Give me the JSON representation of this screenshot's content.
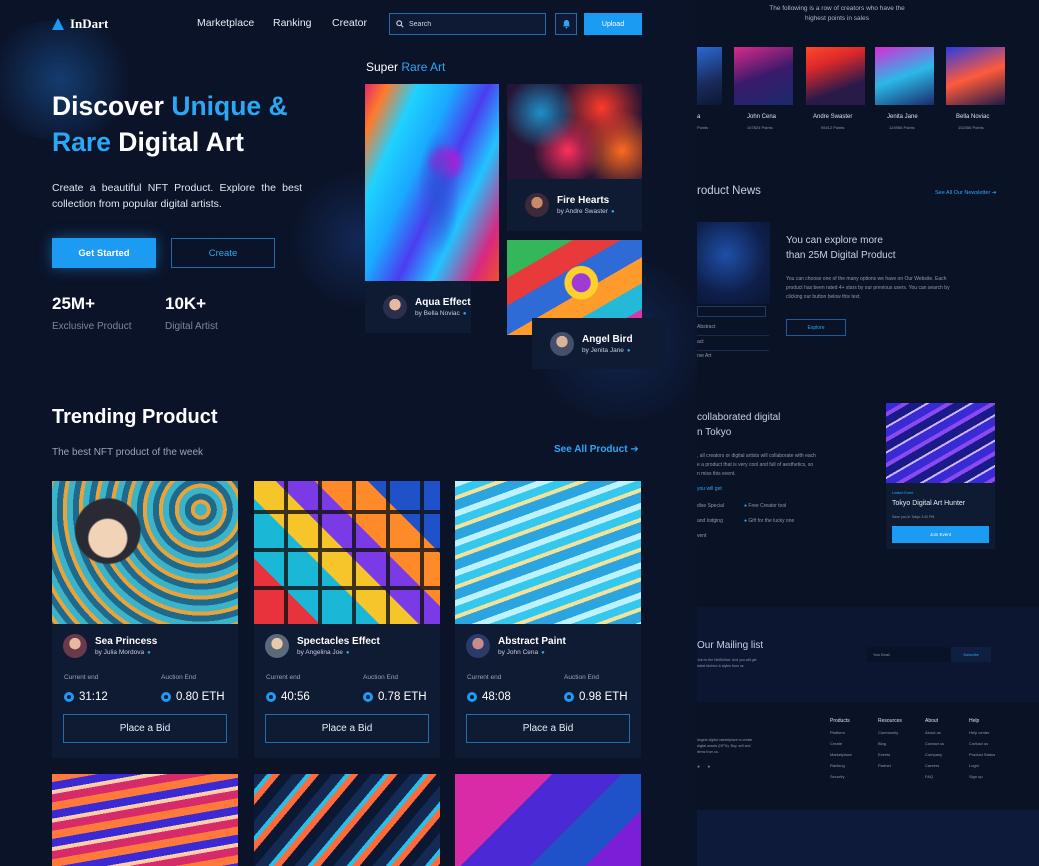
{
  "brand": {
    "name": "InDart"
  },
  "nav": {
    "links": [
      "Marketplace",
      "Ranking",
      "Creator"
    ],
    "search_placeholder": "Search",
    "upload_label": "Upload"
  },
  "hero": {
    "title_parts": [
      "Discover ",
      "Unique &",
      "Rare",
      " Digital Art"
    ],
    "description": "Create a beautiful NFT Product. Explore the best collection from popular digital artists.",
    "primary_button": "Get Started",
    "secondary_button": "Create",
    "stats": [
      {
        "value": "25M+",
        "label": "Exclusive Product"
      },
      {
        "value": "10K+",
        "label": "Digital Artist"
      }
    ]
  },
  "super_rare": {
    "title_white": "Super ",
    "title_blue": "Rare Art",
    "items": [
      {
        "name": "Aqua Effect",
        "by": "by Bella Noviac"
      },
      {
        "name": "Fire Hearts",
        "by": "by Andre Swaster"
      },
      {
        "name": "Angel Bird",
        "by": "by Jenita Jane"
      }
    ]
  },
  "trending": {
    "title": "Trending Product",
    "subtitle": "The best NFT product of the week",
    "see_all": "See All Product",
    "current_end_label": "Current end",
    "auction_end_label": "Auction End",
    "bid_label": "Place a Bid",
    "products": [
      {
        "name": "Sea Princess",
        "by": "by Julia Mordova",
        "current_end": "31:12",
        "auction_end": "0.80 ETH"
      },
      {
        "name": "Spectacles Effect",
        "by": "by Angelina Joe",
        "current_end": "40:56",
        "auction_end": "0.78 ETH"
      },
      {
        "name": "Abstract Paint",
        "by": "by John Cena",
        "current_end": "48:08",
        "auction_end": "0.98 ETH"
      }
    ]
  },
  "side": {
    "top_text_1": "The following is a row of creators who have the",
    "top_text_2": "highest points in sales",
    "creators": [
      {
        "name": "a",
        "points": "Points"
      },
      {
        "name": "John Cena",
        "points": "107824 Points"
      },
      {
        "name": "Andre Swaster",
        "points": "95412 Points"
      },
      {
        "name": "Jenita Jane",
        "points": "124956 Points"
      },
      {
        "name": "Bella Noviac",
        "points": "102456 Points"
      }
    ],
    "news_title": "roduct News",
    "news_link": "See All Our Newsletter",
    "news_heading_1": "You can explore more",
    "news_heading_2": "than 25M Digital Product",
    "news_body_1": "You can choose one of the many options we have on Our Website. Each",
    "news_body_2": "product has been rated 4+ stars by our previous users. You can search by",
    "news_body_3": "clicking our button below this text.",
    "explore_label": "Explore",
    "news_list": [
      "Abstract",
      "act",
      "rse Art"
    ],
    "event_title_1": "collaborated digital",
    "event_title_2": "n Tokyo",
    "event_desc_1": ", all creators or digital artists will collaborate with each",
    "event_desc_2": "e a product that is very cool and full of aesthetics, so",
    "event_desc_3": "n miss this event.",
    "event_get": "you will get",
    "event_items": [
      "dise Special",
      "Free Creator tool",
      "and lodging",
      "Gift for the lucky one",
      "vent"
    ],
    "event_card_tag": "Limited Event",
    "event_card_title": "Tokyo Digital Art Hunter",
    "event_card_date": "Save you in Tokyo 3.00 PM",
    "event_card_button": "Join Event",
    "mail_title": "Our Mailing list",
    "mail_desc_1": "Join to the NetDeliver. And you will get",
    "mail_desc_2": "latest fashion & styles from us",
    "mail_placeholder": "Your Email",
    "mail_button": "Subscribe",
    "footer_desc_1": "largest digital marketplace to create",
    "footer_desc_2": "digital assets (NFTs). Buy, sell and",
    "footer_desc_3": "items from us.",
    "footer_cols": [
      {
        "title": "Products",
        "items": [
          "Platform",
          "Create",
          "Marketplace",
          "Ranking",
          "Security"
        ]
      },
      {
        "title": "Resources",
        "items": [
          "Community",
          "Blog",
          "Events",
          "Partner"
        ]
      },
      {
        "title": "About",
        "items": [
          "About us",
          "Contact us",
          "Company",
          "Careers",
          "FAQ"
        ]
      },
      {
        "title": "Help",
        "items": [
          "Help center",
          "Contact us",
          "Product Status",
          "Login",
          "Sign up"
        ]
      }
    ]
  }
}
